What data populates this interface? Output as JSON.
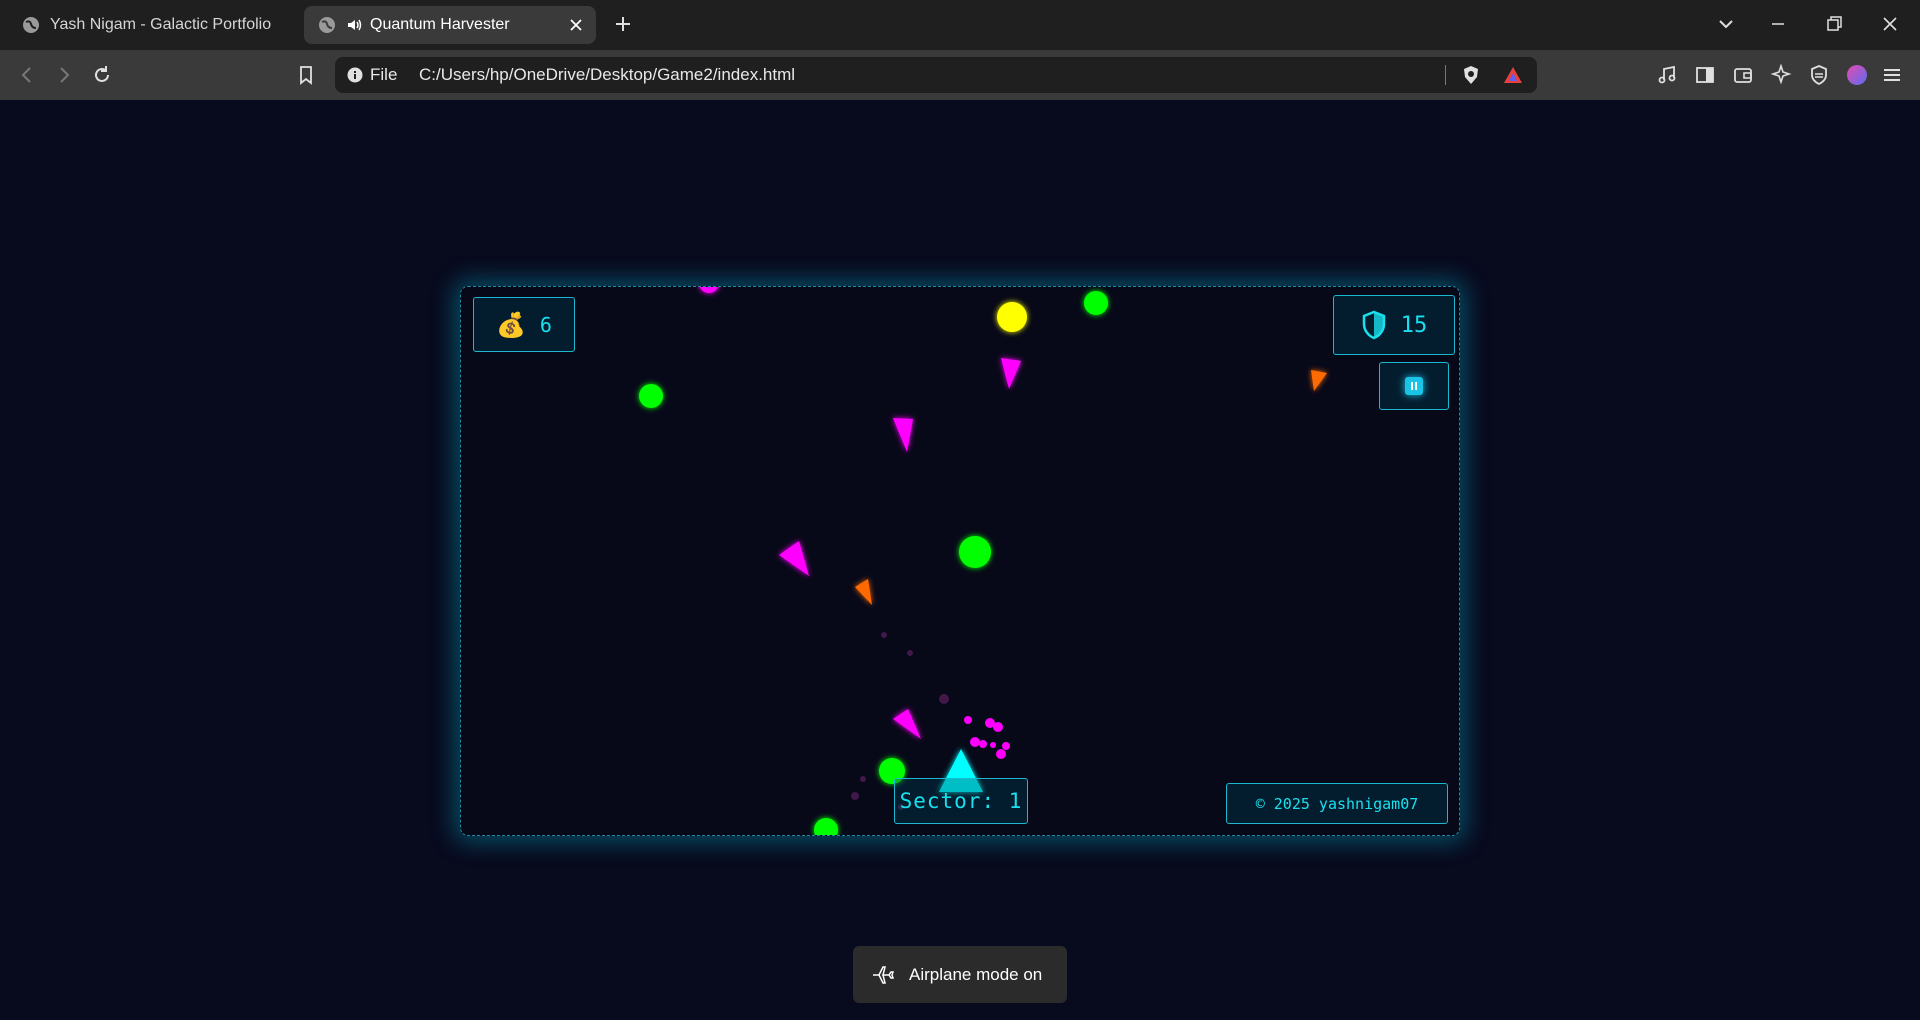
{
  "browser": {
    "tabs": [
      {
        "title": "Yash Nigam - Galactic Portfolio",
        "active": false
      },
      {
        "title": "Quantum Harvester",
        "active": true,
        "audio": true
      }
    ],
    "address": {
      "scheme_label": "File",
      "url": "C:/Users/hp/OneDrive/Desktop/Game2/index.html"
    },
    "icons": [
      "back-icon",
      "forward-icon",
      "reload-icon",
      "bookmark-icon",
      "brave-shields-icon",
      "brave-rewards-icon",
      "music-icon",
      "sidebar-icon",
      "wallet-icon",
      "leo-ai-icon",
      "vpn-icon",
      "profile-icon",
      "menu-icon"
    ]
  },
  "game": {
    "coins": {
      "icon": "money-bag-icon",
      "value": "6"
    },
    "shield": {
      "icon": "shield-icon",
      "value": "15"
    },
    "pause": {
      "icon": "pause-icon"
    },
    "sector_label": "Sector: 1",
    "copyright": "© 2025 yashnigam07",
    "colors": {
      "player": "#00ffff",
      "orb": "#00ff00",
      "gold": "#ffff00",
      "enemy": "#ff00ff",
      "hazard": "#ff6a00",
      "accent": "#19e0ee"
    }
  },
  "notification": {
    "text": "Airplane mode on",
    "icon": "airplane-icon"
  }
}
